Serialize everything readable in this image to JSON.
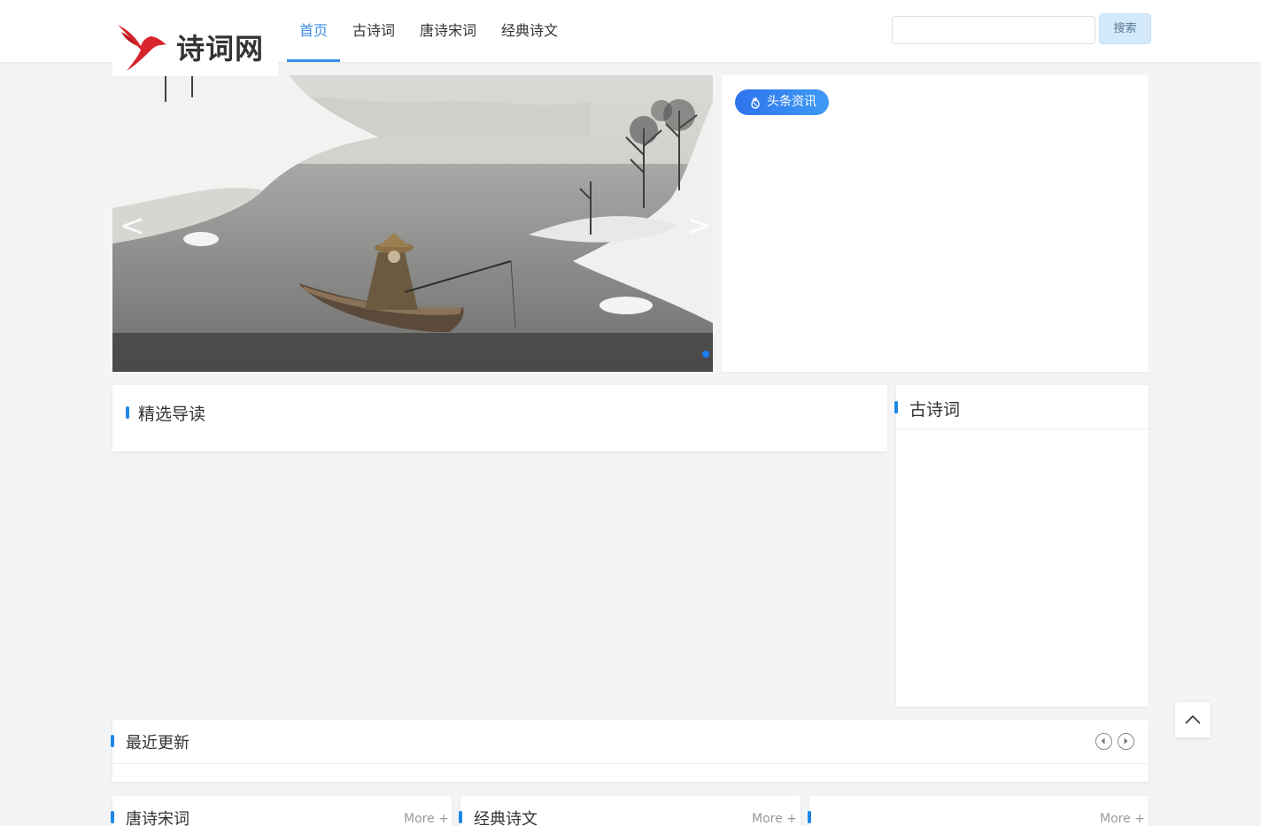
{
  "site": {
    "logo_text": "诗词网"
  },
  "nav": [
    {
      "label": "首页",
      "active": true
    },
    {
      "label": "古诗词",
      "active": false
    },
    {
      "label": "唐诗宋词",
      "active": false
    },
    {
      "label": "经典诗文",
      "active": false
    }
  ],
  "search": {
    "placeholder": "",
    "value": "",
    "button_label": "搜索"
  },
  "carousel": {
    "prev_arrow": "<",
    "next_arrow": ">",
    "slide_count": 1,
    "active_slide": 1
  },
  "headline": {
    "badge_label": "头条资讯"
  },
  "featured": {
    "title": "精选导读"
  },
  "ancient_poems": {
    "title": "古诗词"
  },
  "recent": {
    "title": "最近更新"
  },
  "cards": [
    {
      "title": "唐诗宋词",
      "more": "More +"
    },
    {
      "title": "经典诗文",
      "more": "More +"
    },
    {
      "title": "",
      "more": "More +"
    }
  ],
  "colors": {
    "accent": "#3a8ee6",
    "section_bar": "#1e88e5",
    "badge_start": "#2f73ee",
    "badge_end": "#3d9bf4"
  }
}
